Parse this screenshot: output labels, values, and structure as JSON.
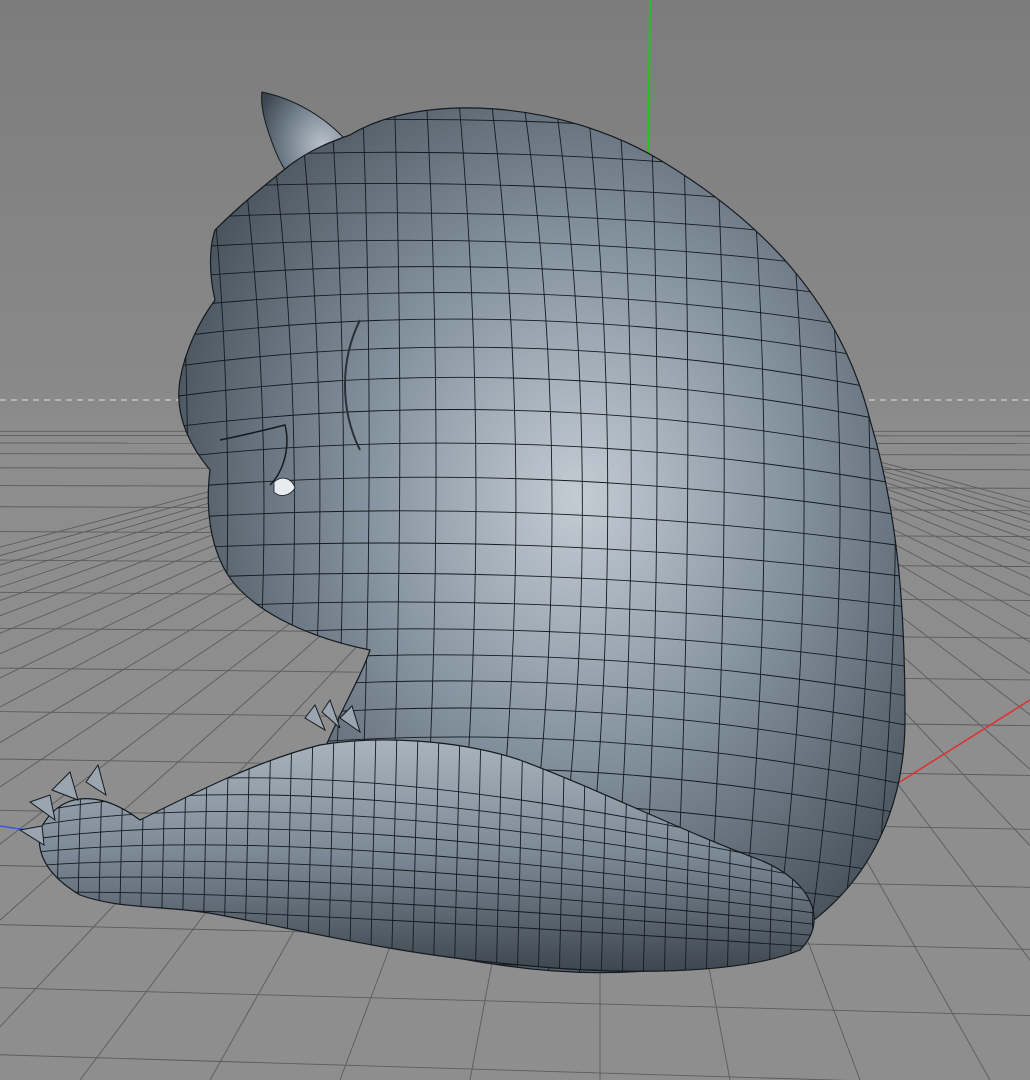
{
  "viewport": {
    "shading_mode": "gouraud-shaded-with-wireframe-lines",
    "camera": "perspective",
    "grid_visible": true,
    "horizon_visible": true
  },
  "colors": {
    "background_top": "#7c7c7c",
    "floor": "#8e8e8e",
    "grid_line": "#5c5c5c",
    "horizon_dash": "#cfcfcf",
    "model_base": "#6a7883",
    "model_highlight": "#c4ccd3",
    "model_shadow": "#3d464e",
    "wire": "#141a1f",
    "axis_y": "#22c222",
    "axis_x": "#e03030",
    "axis_z": "#3a5ad8"
  },
  "icons": {
    "world_y_axis": "axis-y-line-icon",
    "world_x_axis": "axis-x-line-icon",
    "world_z_axis": "axis-z-line-icon"
  },
  "model": {
    "description_tag": "creature-sculpt-polygon-mesh"
  }
}
